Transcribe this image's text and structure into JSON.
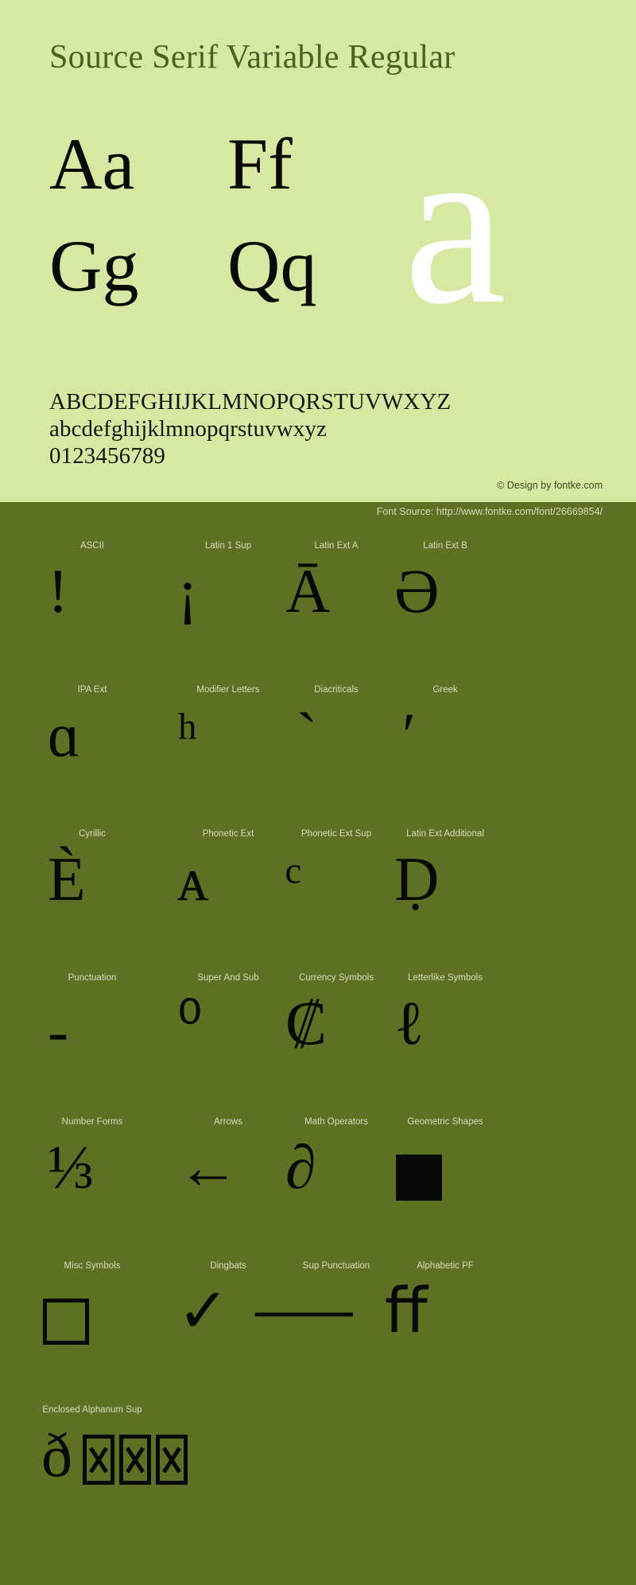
{
  "specimen": {
    "title": "Source Serif Variable Regular",
    "pairs": [
      "Aa",
      "Ff",
      "Gg",
      "Qq"
    ],
    "big_letter": "a",
    "alphabet_upper": "ABCDEFGHIJKLMNOPQRSTUVWXYZ",
    "alphabet_lower": "abcdefghijklmnopqrstuvwxyz",
    "digits": "0123456789",
    "design_credit": "© Design by fontke.com",
    "font_source": "Font Source: http://www.fontke.com/font/26669854/"
  },
  "colors": {
    "panel_bg": "#d7e8a2",
    "blocks_bg": "#5d7023",
    "title_color": "#4e6020",
    "glyph_color": "#080806",
    "label_color": "#d5ddbe",
    "big_letter_color": "#ffffff"
  },
  "unicode_blocks": [
    {
      "label": "ASCII",
      "glyph": "!"
    },
    {
      "label": "Latin 1 Sup",
      "glyph": "¡"
    },
    {
      "label": "Latin Ext A",
      "glyph": "Ā"
    },
    {
      "label": "Latin Ext B",
      "glyph": "Ə"
    },
    {
      "label": "IPA Ext",
      "glyph": "ɑ"
    },
    {
      "label": "Modifier Letters",
      "glyph": "ʰ"
    },
    {
      "label": "Diacriticals",
      "glyph": "`"
    },
    {
      "label": "Greek",
      "glyph": "ʹ"
    },
    {
      "label": "Cyrillic",
      "glyph": "Ѐ"
    },
    {
      "label": "Phonetic Ext",
      "glyph": "ᴀ"
    },
    {
      "label": "Phonetic Ext Sup",
      "glyph": "ᶜ"
    },
    {
      "label": "Latin Ext Additional",
      "glyph": "Ḍ"
    },
    {
      "label": "Punctuation",
      "glyph": "‐"
    },
    {
      "label": "Super And Sub",
      "glyph": "⁰"
    },
    {
      "label": "Currency Symbols",
      "glyph": "₡"
    },
    {
      "label": "Letterlike Symbols",
      "glyph": "ℓ"
    },
    {
      "label": "Number Forms",
      "glyph": "⅓"
    },
    {
      "label": "Arrows",
      "glyph": "←"
    },
    {
      "label": "Math Operators",
      "glyph": "∂"
    },
    {
      "label": "Geometric Shapes",
      "glyph": "■"
    },
    {
      "label": "Misc Symbols",
      "glyph": "☐"
    },
    {
      "label": "Dingbats",
      "glyph": "✓"
    },
    {
      "label": "Sup Punctuation",
      "glyph": "⸺"
    },
    {
      "label": "Alphabetic PF",
      "glyph": "ﬀ"
    },
    {
      "label": "Enclosed Alphanum Sup",
      "glyph": "🄐"
    }
  ]
}
